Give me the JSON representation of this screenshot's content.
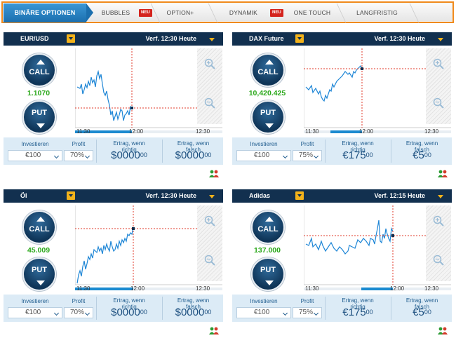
{
  "tabs": [
    {
      "label": "BINÄRE OPTIONEN",
      "active": true
    },
    {
      "label": "BUBBLES",
      "badge": "NEU"
    },
    {
      "label": "OPTION+"
    },
    {
      "label": "DYNAMIK",
      "badge": "NEU"
    },
    {
      "label": "ONE TOUCH"
    },
    {
      "label": "LANGFRISTIG"
    }
  ],
  "common": {
    "call": "CALL",
    "put": "PUT",
    "investieren": "Investieren",
    "profit": "Profit",
    "ertrag_richtig_1": "Ertrag, wenn",
    "ertrag_richtig_2": "richtig",
    "ertrag_falsch_1": "Ertrag, wenn",
    "ertrag_falsch_2": "falsch"
  },
  "panels": [
    {
      "asset": "EUR/USD",
      "expiry": "Verf. 12:30 Heute",
      "price": "1.1070",
      "invest": "€100",
      "profit": "70%",
      "ertrag_richtig": "$0000",
      "ertrag_richtig_cents": "00",
      "ertrag_falsch": "$0000",
      "ertrag_falsch_cents": "00",
      "ticks": [
        "11:30",
        "12:00",
        "12:30"
      ]
    },
    {
      "asset": "DAX Future",
      "expiry": "Verf. 12:30 Heute",
      "price": "10,420.425",
      "invest": "€100",
      "profit": "75%",
      "ertrag_richtig": "€175",
      "ertrag_richtig_cents": "00",
      "ertrag_falsch": "€5",
      "ertrag_falsch_cents": "00",
      "ticks": [
        "11:30",
        "12:00",
        "12:30"
      ]
    },
    {
      "asset": "Öl",
      "expiry": "Verf. 12:30 Heute",
      "price": "45.009",
      "invest": "€100",
      "profit": "70%",
      "ertrag_richtig": "$0000",
      "ertrag_richtig_cents": "00",
      "ertrag_falsch": "$0000",
      "ertrag_falsch_cents": "00",
      "ticks": [
        "11:30",
        "12:00",
        "12:30"
      ]
    },
    {
      "asset": "Adidas",
      "expiry": "Verf. 12:15 Heute",
      "price": "137.000",
      "invest": "€100",
      "profit": "75%",
      "ertrag_richtig": "€175",
      "ertrag_richtig_cents": "00",
      "ertrag_falsch": "€5",
      "ertrag_falsch_cents": "00",
      "ticks": [
        "11:30",
        "12:00",
        "12:30"
      ]
    }
  ],
  "colors": {
    "accent": "#1b6fae",
    "header": "#12304f",
    "price": "#2aa81a",
    "line": "#1e86d6",
    "marker": "#e03a2a"
  }
}
